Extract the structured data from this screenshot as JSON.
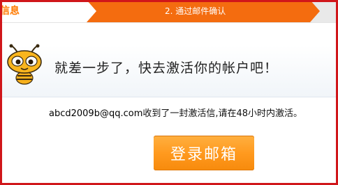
{
  "steps": {
    "previous_label": "信息",
    "current_label": "2. 通过邮件确认"
  },
  "main": {
    "headline": "就差一步了，快去激活你的帐户吧！",
    "notice": {
      "email": "abcd2009b@qq.com",
      "message": "收到了一封激活信,请在48小时内激活。"
    },
    "login_button_label": "登录邮箱"
  },
  "colors": {
    "step_active": "#f46c0f",
    "button": "#ff9a1f",
    "frame": "#d0161a"
  },
  "icons": {
    "mascot": "bee-mascot-icon"
  }
}
